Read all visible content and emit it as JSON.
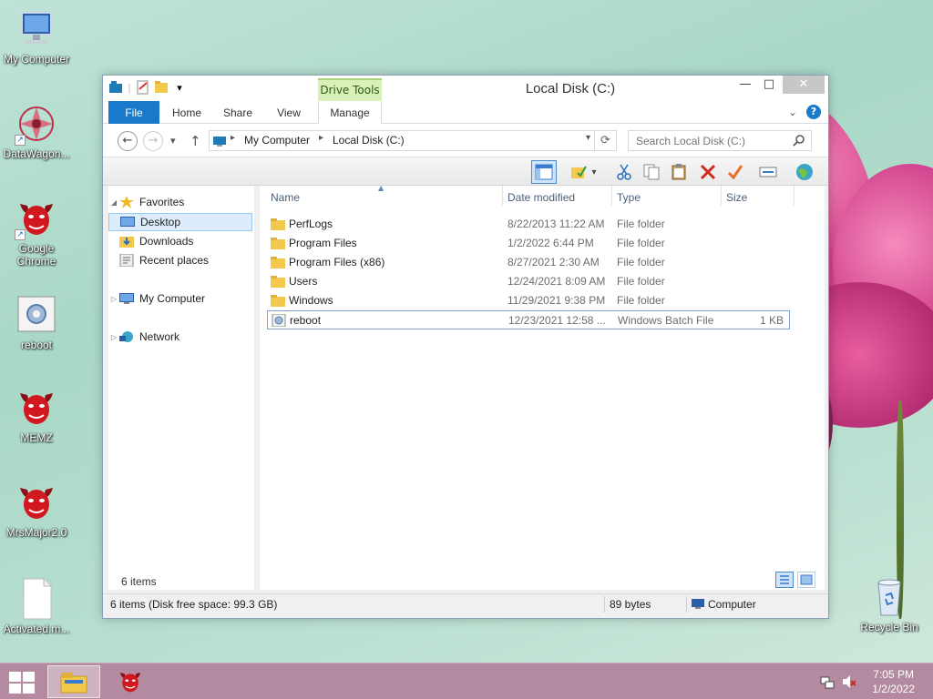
{
  "desktop": {
    "icons": [
      {
        "label": "My Computer"
      },
      {
        "label": "DataWagon..."
      },
      {
        "label": "Google Chrome"
      },
      {
        "label": "reboot"
      },
      {
        "label": "MEMZ"
      },
      {
        "label": "MrsMajor2.0"
      },
      {
        "label": "Activated.m..."
      },
      {
        "label": "Recycle Bin"
      }
    ]
  },
  "window": {
    "title": "Local Disk (C:)",
    "context_tab": "Drive Tools",
    "controls": {
      "minimize": "—",
      "maximize": "□",
      "close": "✕"
    },
    "tabs": [
      {
        "label": "File"
      },
      {
        "label": "Home"
      },
      {
        "label": "Share"
      },
      {
        "label": "View"
      },
      {
        "label": "Manage"
      }
    ],
    "address": {
      "crumbs": [
        "My Computer",
        "Local Disk (C:)"
      ]
    },
    "search": {
      "placeholder": "Search Local Disk (C:)"
    },
    "nav_pane": {
      "favorites": "Favorites",
      "desktop": "Desktop",
      "downloads": "Downloads",
      "recent": "Recent places",
      "computer": "My Computer",
      "network": "Network"
    },
    "columns": {
      "name": "Name",
      "date": "Date modified",
      "type": "Type",
      "size": "Size"
    },
    "files": [
      {
        "name": "PerfLogs",
        "date": "8/22/2013 11:22 AM",
        "type": "File folder",
        "size": ""
      },
      {
        "name": "Program Files",
        "date": "1/2/2022 6:44 PM",
        "type": "File folder",
        "size": ""
      },
      {
        "name": "Program Files (x86)",
        "date": "8/27/2021 2:30 AM",
        "type": "File folder",
        "size": ""
      },
      {
        "name": "Users",
        "date": "12/24/2021 8:09 AM",
        "type": "File folder",
        "size": ""
      },
      {
        "name": "Windows",
        "date": "11/29/2021 9:38 PM",
        "type": "File folder",
        "size": ""
      },
      {
        "name": "reboot",
        "date": "12/23/2021 12:58 ...",
        "type": "Windows Batch File",
        "size": "1 KB"
      }
    ],
    "item_count": "6 items",
    "status": {
      "summary": "6 items (Disk free space: 99.3 GB)",
      "size": "89 bytes",
      "location": "Computer"
    }
  },
  "taskbar": {
    "time": "7:05 PM",
    "date": "1/2/2022"
  }
}
